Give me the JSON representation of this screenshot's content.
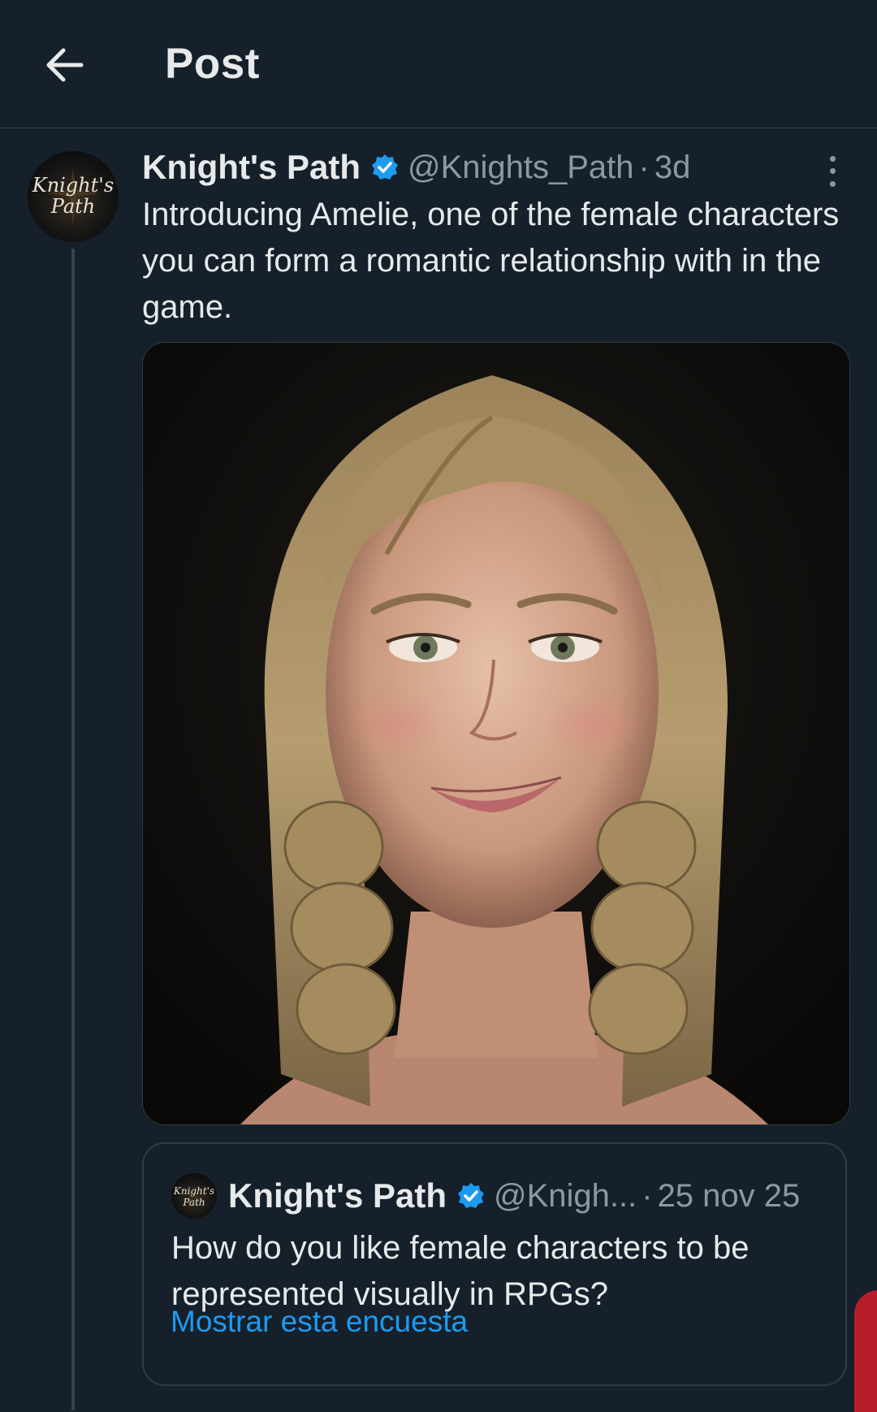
{
  "header": {
    "back_icon": "arrow-left-icon",
    "title": "Post"
  },
  "post": {
    "author_name": "Knight's Path",
    "verified_icon": "verified-badge-icon",
    "handle": "@Knights_Path",
    "separator": "·",
    "time": "3d",
    "more_icon": "more-vertical-icon",
    "text": "Introducing Amelie, one of the female characters you can form a romantic relationship with in the game.",
    "avatar_logo_lines": [
      "Knight's",
      "Path"
    ],
    "media_description_icon": "portrait-image"
  },
  "quoted_post": {
    "author_name": "Knight's Path",
    "verified_icon": "verified-badge-icon",
    "handle": "@Knigh...",
    "separator": "·",
    "time": "25 nov 25",
    "text": "How do you like female characters to be represented visually in RPGs?",
    "poll_link": "Mostrar esta encuesta"
  },
  "colors": {
    "background": "#15202b",
    "text": "#e7e9ea",
    "secondary": "#8b98a5",
    "accent_blue": "#1d9bf0",
    "border": "#38444d"
  }
}
